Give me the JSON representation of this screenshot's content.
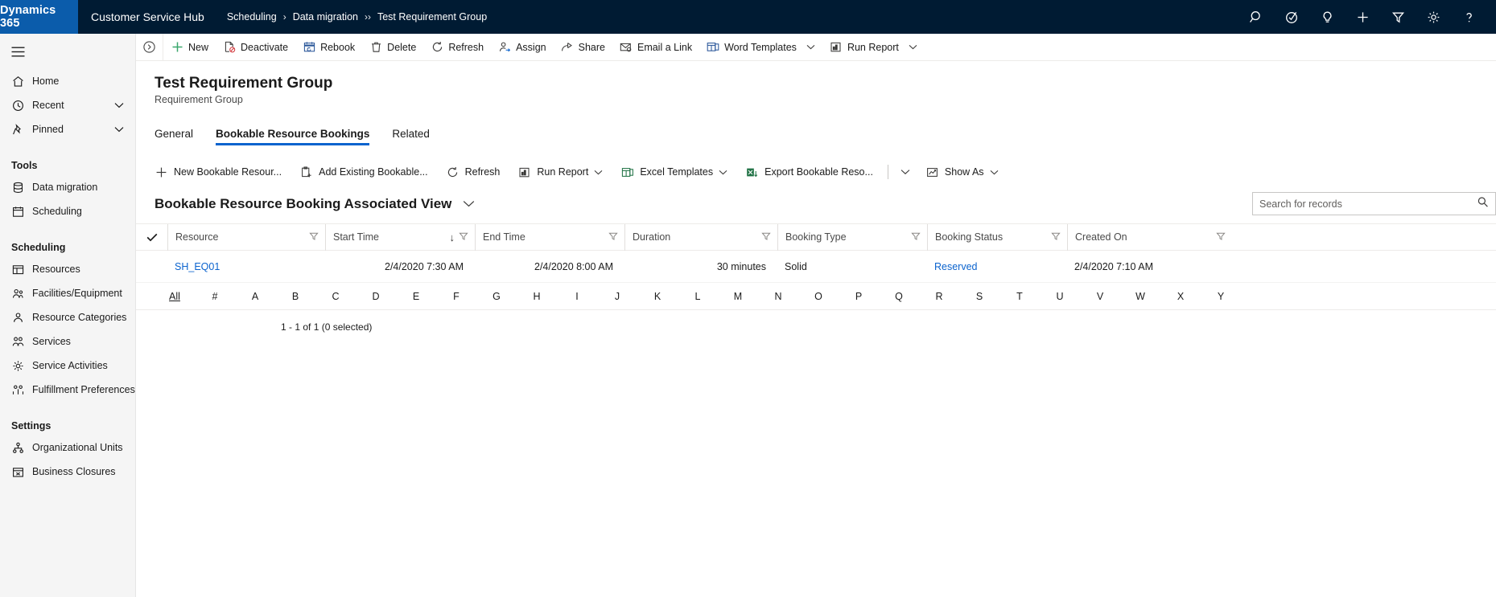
{
  "topnav": {
    "brand": "Dynamics 365",
    "app_name": "Customer Service Hub",
    "breadcrumb": [
      {
        "label": "Scheduling",
        "sep": "›"
      },
      {
        "label": "Data migration",
        "sep": "››"
      },
      {
        "label": "Test Requirement Group",
        "sep": ""
      }
    ],
    "icons": [
      {
        "name": "search-icon",
        "title": "Search"
      },
      {
        "name": "assistant-icon",
        "title": "Relationship assistant"
      },
      {
        "name": "lightbulb-icon",
        "title": "Insights"
      },
      {
        "name": "quick-create-icon",
        "title": "Quick create"
      },
      {
        "name": "filter-icon",
        "title": "Filter"
      },
      {
        "name": "settings-gear-icon",
        "title": "Settings"
      },
      {
        "name": "help-icon",
        "title": "Help"
      }
    ]
  },
  "sidebar": {
    "nav": [
      {
        "label": "Home",
        "icon": "home-icon",
        "chevron": false
      },
      {
        "label": "Recent",
        "icon": "clock-icon",
        "chevron": true
      },
      {
        "label": "Pinned",
        "icon": "pin-icon",
        "chevron": true
      }
    ],
    "groups": [
      {
        "title": "Tools",
        "items": [
          {
            "label": "Data migration",
            "icon": "data-migration-icon"
          },
          {
            "label": "Scheduling",
            "icon": "scheduling-icon"
          }
        ]
      },
      {
        "title": "Scheduling",
        "items": [
          {
            "label": "Resources",
            "icon": "resources-icon"
          },
          {
            "label": "Facilities/Equipment",
            "icon": "facilities-icon"
          },
          {
            "label": "Resource Categories",
            "icon": "resource-categories-icon"
          },
          {
            "label": "Services",
            "icon": "services-icon"
          },
          {
            "label": "Service Activities",
            "icon": "service-activities-icon"
          },
          {
            "label": "Fulfillment Preferences",
            "icon": "fulfillment-icon"
          }
        ]
      },
      {
        "title": "Settings",
        "items": [
          {
            "label": "Organizational Units",
            "icon": "org-units-icon"
          },
          {
            "label": "Business Closures",
            "icon": "business-closures-icon"
          }
        ]
      }
    ]
  },
  "command_bar": [
    {
      "label": "New",
      "icon": "plus-icon",
      "chevron": false
    },
    {
      "label": "Deactivate",
      "icon": "deactivate-icon",
      "chevron": false
    },
    {
      "label": "Rebook",
      "icon": "rebook-calendar-icon",
      "chevron": false
    },
    {
      "label": "Delete",
      "icon": "trash-icon",
      "chevron": false
    },
    {
      "label": "Refresh",
      "icon": "refresh-icon",
      "chevron": false
    },
    {
      "label": "Assign",
      "icon": "assign-person-icon",
      "chevron": false
    },
    {
      "label": "Share",
      "icon": "share-icon",
      "chevron": false
    },
    {
      "label": "Email a Link",
      "icon": "email-link-icon",
      "chevron": false
    },
    {
      "label": "Word Templates",
      "icon": "word-icon",
      "chevron": true
    },
    {
      "label": "Run Report",
      "icon": "report-icon",
      "chevron": true
    }
  ],
  "record": {
    "title": "Test Requirement Group",
    "subtitle": "Requirement Group"
  },
  "tabs": [
    {
      "label": "General",
      "active": false
    },
    {
      "label": "Bookable Resource Bookings",
      "active": true
    },
    {
      "label": "Related",
      "active": false
    }
  ],
  "subgrid_commands": [
    {
      "label": "New Bookable Resour...",
      "icon": "plus-icon",
      "chevron": false
    },
    {
      "label": "Add Existing Bookable...",
      "icon": "add-existing-icon",
      "chevron": false
    },
    {
      "label": "Refresh",
      "icon": "refresh-icon",
      "chevron": false
    },
    {
      "label": "Run Report",
      "icon": "report-icon",
      "chevron": true
    },
    {
      "label": "Excel Templates",
      "icon": "excel-icon",
      "chevron": true
    },
    {
      "label": "Export Bookable Reso...",
      "icon": "export-excel-icon",
      "chevron": false
    },
    {
      "label": "",
      "icon": "overflow-chevron-icon",
      "chevron": true
    },
    {
      "label": "Show As",
      "icon": "show-as-chart-icon",
      "chevron": true
    }
  ],
  "view": {
    "name": "Bookable Resource Booking Associated View",
    "selector_icon": "chevron-down-icon"
  },
  "search": {
    "placeholder": "Search for records",
    "value": "",
    "icon": "search-icon"
  },
  "grid": {
    "columns": [
      {
        "label": "Resource",
        "key": "resource",
        "sorted": false,
        "filter": true,
        "align": "left",
        "cls": "col-resource"
      },
      {
        "label": "Start Time",
        "key": "start_time",
        "sorted": true,
        "sort_dir": "↓",
        "filter": true,
        "align": "right",
        "cls": "col-start"
      },
      {
        "label": "End Time",
        "key": "end_time",
        "sorted": false,
        "filter": true,
        "align": "right",
        "cls": "col-end"
      },
      {
        "label": "Duration",
        "key": "duration",
        "sorted": false,
        "filter": true,
        "align": "right",
        "cls": "col-duration"
      },
      {
        "label": "Booking Type",
        "key": "booking_type",
        "sorted": false,
        "filter": true,
        "align": "left",
        "cls": "col-btype"
      },
      {
        "label": "Booking Status",
        "key": "booking_status",
        "sorted": false,
        "filter": true,
        "align": "left",
        "cls": "col-bstatus"
      },
      {
        "label": "Created On",
        "key": "created_on",
        "sorted": false,
        "filter": true,
        "align": "left",
        "cls": "col-created"
      }
    ],
    "rows": [
      {
        "resource": "SH_EQ01",
        "start_time": "2/4/2020 7:30 AM",
        "end_time": "2/4/2020 8:00 AM",
        "duration": "30 minutes",
        "booking_type": "Solid",
        "booking_status": "Reserved",
        "created_on": "2/4/2020 7:10 AM"
      }
    ]
  },
  "alpha_index": [
    "All",
    "#",
    "A",
    "B",
    "C",
    "D",
    "E",
    "F",
    "G",
    "H",
    "I",
    "J",
    "K",
    "L",
    "M",
    "N",
    "O",
    "P",
    "Q",
    "R",
    "S",
    "T",
    "U",
    "V",
    "W",
    "X",
    "Y"
  ],
  "alpha_selected": "All",
  "record_count": "1 - 1 of 1 (0 selected)",
  "colors": {
    "nav_bg": "#001b33",
    "brand_bg": "#0b5cab",
    "accent": "#0b63ce",
    "link": "#0b63ce",
    "sidebar_bg": "#f5f5f5"
  }
}
